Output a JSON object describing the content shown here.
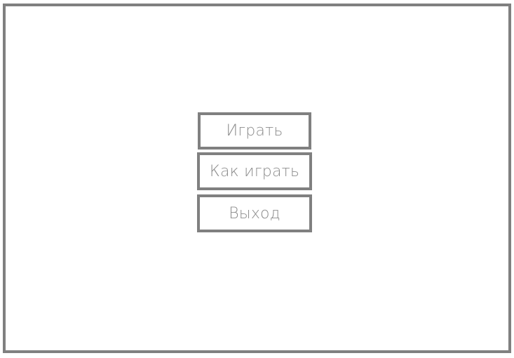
{
  "main_menu": {
    "buttons": [
      {
        "id": "play",
        "label": "Играть"
      },
      {
        "id": "how_to_play",
        "label": "Как играть"
      },
      {
        "id": "exit",
        "label": "Выход"
      }
    ]
  },
  "colors": {
    "border": "#808080",
    "text": "#8c8c8c",
    "background": "#ffffff"
  }
}
